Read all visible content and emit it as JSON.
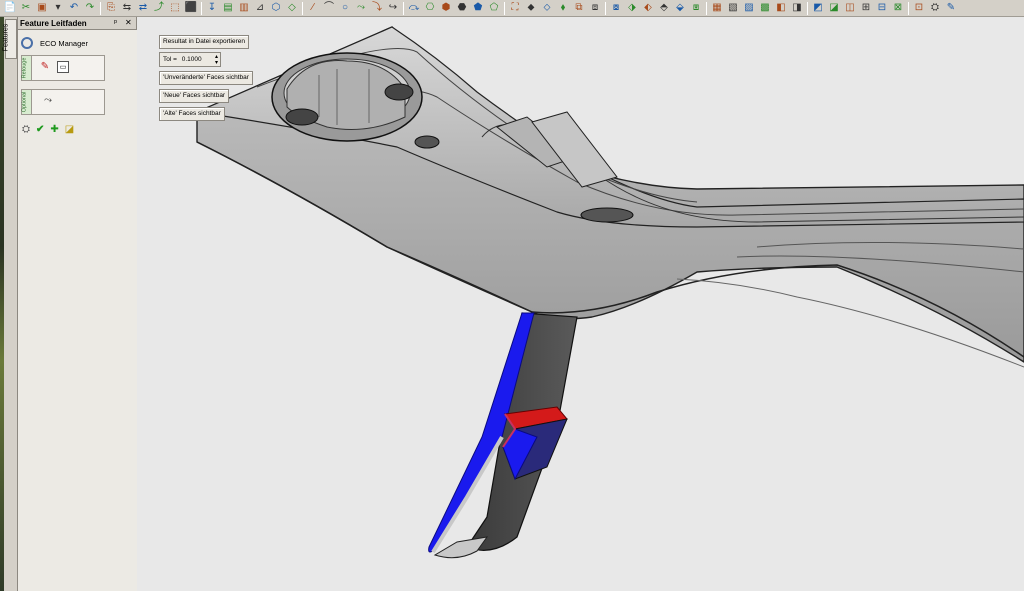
{
  "toolbar": {
    "icons": [
      "📄",
      "✂",
      "▣",
      "▾",
      "↶",
      "↷",
      "⎘",
      "⇆",
      "⇄",
      "⤴",
      "⬚",
      "⬛",
      "↧",
      "▤",
      "▥",
      "⊿",
      "⬡",
      "◇",
      "∕",
      "⌒",
      "○",
      "⤳",
      "⤵",
      "↪",
      "⤼",
      "⎔",
      "⬢",
      "⬣",
      "⬟",
      "⬠",
      "⛶",
      "⬥",
      "⬦",
      "⬧",
      "⧉",
      "⧈",
      "⧇",
      "⬗",
      "⬖",
      "⬘",
      "⬙",
      "⧆",
      "▦",
      "▧",
      "▨",
      "▩",
      "◧",
      "◨",
      "◩",
      "◪",
      "◫",
      "⊞",
      "⊟",
      "⊠",
      "⊡",
      "⛭",
      "✎"
    ]
  },
  "side_tab": {
    "label": "Features"
  },
  "panel": {
    "title": "Feature Leitfaden",
    "pin": "ᵖ",
    "close": "✕",
    "eco_label": "ECO Manager",
    "group1_tab": "Retouge",
    "group2_tab": "Optional"
  },
  "viewport": {
    "export_button": "Resultat in Datei exportieren",
    "tol_label": "Tol =",
    "tol_value": "0.1000",
    "unchanged_faces_button": "'Unveränderte' Faces sichtbar",
    "new_faces_button": "'Neue' Faces sichtbar",
    "old_faces_button": "'Alte' Faces sichtbar"
  },
  "colors": {
    "viewport_bg": "#e8e8e8",
    "part_gray": "#b8b8b8",
    "new_faces": "#1a1aee",
    "old_faces": "#d41a1a",
    "confirm_green": "#1e9a1e"
  }
}
